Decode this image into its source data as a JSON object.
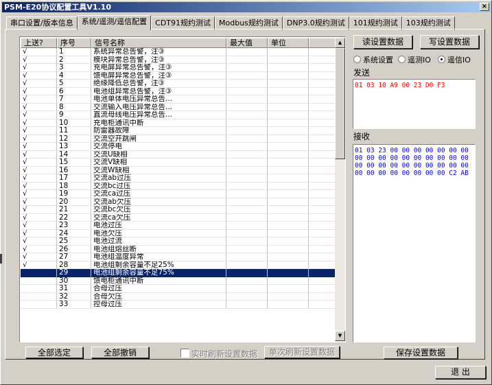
{
  "window": {
    "title": "PSM-E20协议配置工具V1.10",
    "close_label": "×"
  },
  "tabs": [
    {
      "label": "串口设置/版本信息",
      "active": false
    },
    {
      "label": "系统/遥测/遥信配置",
      "active": true
    },
    {
      "label": "CDT91规约测试",
      "active": false
    },
    {
      "label": "Modbus规约测试",
      "active": false
    },
    {
      "label": "DNP3.0规约测试",
      "active": false
    },
    {
      "label": "101规约测试",
      "active": false
    },
    {
      "label": "103规约测试",
      "active": false
    }
  ],
  "grid": {
    "columns": [
      "上送?",
      "序号",
      "信号名称",
      "最大值",
      "单位"
    ],
    "selected_row": 29,
    "rows": [
      {
        "upload": "√",
        "no": "1",
        "name": "系统异常总告警，注③"
      },
      {
        "upload": "√",
        "no": "2",
        "name": "模块异常总告警，注③"
      },
      {
        "upload": "√",
        "no": "3",
        "name": "充电屏异常总告警，注③"
      },
      {
        "upload": "√",
        "no": "4",
        "name": "馈电屏异常总告警，注③"
      },
      {
        "upload": "√",
        "no": "5",
        "name": "绝缘降低总告警，注③"
      },
      {
        "upload": "√",
        "no": "6",
        "name": "电池组异常总告警，注③"
      },
      {
        "upload": "√",
        "no": "7",
        "name": "电池单体电压异常总告..."
      },
      {
        "upload": "√",
        "no": "8",
        "name": "交流输入电压异常总告..."
      },
      {
        "upload": "√",
        "no": "9",
        "name": "直流母线电压异常总告..."
      },
      {
        "upload": "√",
        "no": "10",
        "name": "充电柜通讯中断"
      },
      {
        "upload": "√",
        "no": "11",
        "name": "防雷器故障"
      },
      {
        "upload": "√",
        "no": "12",
        "name": "交流空开跳闸"
      },
      {
        "upload": "√",
        "no": "13",
        "name": "交流停电"
      },
      {
        "upload": "√",
        "no": "14",
        "name": "交流U缺相"
      },
      {
        "upload": "√",
        "no": "15",
        "name": "交流V缺相"
      },
      {
        "upload": "√",
        "no": "16",
        "name": "交流W缺相"
      },
      {
        "upload": "√",
        "no": "17",
        "name": "交流ab过压"
      },
      {
        "upload": "√",
        "no": "18",
        "name": "交流bc过压"
      },
      {
        "upload": "√",
        "no": "19",
        "name": "交流ca过压"
      },
      {
        "upload": "√",
        "no": "20",
        "name": "交流ab欠压"
      },
      {
        "upload": "√",
        "no": "21",
        "name": "交流bc欠压"
      },
      {
        "upload": "√",
        "no": "22",
        "name": "交流ca欠压"
      },
      {
        "upload": "√",
        "no": "23",
        "name": "电池过压"
      },
      {
        "upload": "√",
        "no": "24",
        "name": "电池欠压"
      },
      {
        "upload": "√",
        "no": "25",
        "name": "电池过流"
      },
      {
        "upload": "√",
        "no": "26",
        "name": "电池组熔丝断"
      },
      {
        "upload": "√",
        "no": "27",
        "name": "电池组温度异常"
      },
      {
        "upload": "√",
        "no": "28",
        "name": "电池组剩余容量不足25%"
      },
      {
        "upload": "",
        "no": "29",
        "name": "电池组剩余容量不足75%"
      },
      {
        "upload": "",
        "no": "30",
        "name": "馈电柜通讯中断"
      },
      {
        "upload": "",
        "no": "31",
        "name": "合母过压"
      },
      {
        "upload": "",
        "no": "32",
        "name": "合母欠压"
      },
      {
        "upload": "",
        "no": "33",
        "name": "控母过压"
      }
    ]
  },
  "buttons": {
    "select_all": "全部选定",
    "deselect_all": "全部撤销",
    "realtime_refresh": "实时刷新设置数据",
    "single_refresh": "单次刷新设置数据",
    "read_settings": "读设置数据",
    "write_settings": "写设置数据",
    "save_settings": "保存设置数据",
    "exit": "退  出"
  },
  "radios": [
    {
      "label": "系统设置",
      "checked": false
    },
    {
      "label": "遥测IO",
      "checked": false
    },
    {
      "label": "遥信IO",
      "checked": true
    }
  ],
  "send": {
    "label": "发送",
    "text": "01 03 10 A9 00 23 D0 F3",
    "color": "#ff0000"
  },
  "receive": {
    "label": "接收",
    "text": "01 03 23 00 00 00 00 00 00 00\n00 00 00 00 00 00 00 00 00 00\n00 00 00 00 00 00 00 00 00 00\n00 00 00 00 00 00 00 00 C2 AB",
    "color": "#0000ff"
  }
}
